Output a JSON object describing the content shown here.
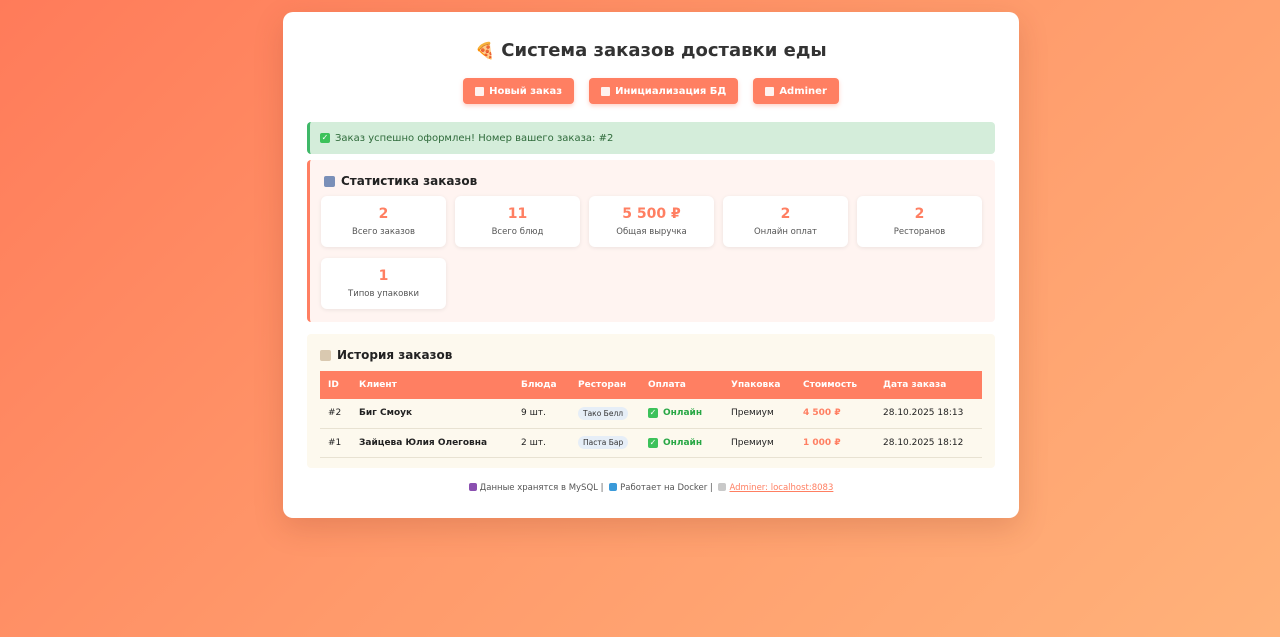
{
  "header": {
    "title": "Система заказов доставки еды",
    "icon": "pizza-icon"
  },
  "toolbar": {
    "buttons": [
      {
        "label": "Новый заказ",
        "icon": "clipboard-icon"
      },
      {
        "label": "Инициализация БД",
        "icon": "tools-icon"
      },
      {
        "label": "Adminer",
        "icon": "chart-icon"
      }
    ]
  },
  "alert": {
    "text": "Заказ успешно оформлен! Номер вашего заказа: #2",
    "color": "#d4edda"
  },
  "stats": {
    "title": "Статистика заказов",
    "items": [
      {
        "value": "2",
        "label": "Всего заказов"
      },
      {
        "value": "11",
        "label": "Всего блюд"
      },
      {
        "value": "5 500 ₽",
        "label": "Общая выручка"
      },
      {
        "value": "2",
        "label": "Онлайн оплат"
      },
      {
        "value": "2",
        "label": "Ресторанов"
      },
      {
        "value": "1",
        "label": "Типов упаковки"
      }
    ]
  },
  "history": {
    "title": "История заказов",
    "columns": [
      "ID",
      "Клиент",
      "Блюда",
      "Ресторан",
      "Оплата",
      "Упаковка",
      "Стоимость",
      "Дата заказа"
    ],
    "rows": [
      {
        "id": "#2",
        "client": "Биг Смоук",
        "dishes": "9 шт.",
        "restaurant": "Тако Белл",
        "payment": "Онлайн",
        "packaging": "Премиум",
        "cost": "4 500 ₽",
        "date": "28.10.2025 18:13"
      },
      {
        "id": "#1",
        "client": "Зайцева Юлия Олеговна",
        "dishes": "2 шт.",
        "restaurant": "Паста Бар",
        "payment": "Онлайн",
        "packaging": "Премиум",
        "cost": "1 000 ₽",
        "date": "28.10.2025 18:12"
      }
    ]
  },
  "footer": {
    "mysql_text": "Данные хранятся в MySQL |",
    "docker_text": "Работает на Docker |",
    "link_text": "Adminer: localhost:8083"
  },
  "colors": {
    "accent": "#ff7f62",
    "success": "#28a745"
  }
}
